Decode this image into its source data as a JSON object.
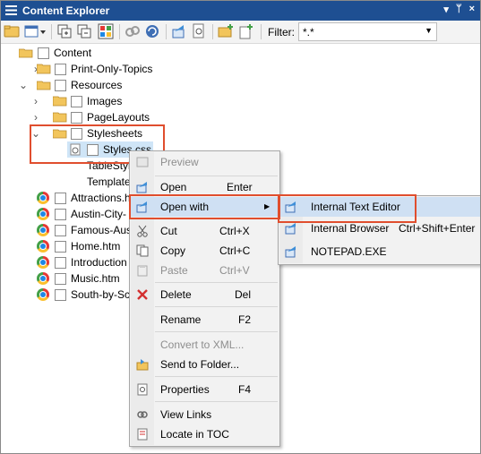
{
  "window": {
    "title": "Content Explorer",
    "pin_glyph": "▾",
    "close_glyph": "×",
    "pin2_glyph": "ᛘ"
  },
  "toolbar": {
    "filter_label": "Filter:",
    "filter_value": "*.*"
  },
  "tree": {
    "root": "Content",
    "items": [
      {
        "label": "Print-Only-Topics"
      },
      {
        "label": "Resources"
      },
      {
        "label": "Images"
      },
      {
        "label": "PageLayouts"
      },
      {
        "label": "Stylesheets"
      },
      {
        "label": "Styles.css"
      },
      {
        "label": "TableStyl"
      },
      {
        "label": "Template"
      },
      {
        "label": "Attractions.h"
      },
      {
        "label": "Austin-City-"
      },
      {
        "label": "Famous-Aus"
      },
      {
        "label": "Home.htm"
      },
      {
        "label": "Introduction"
      },
      {
        "label": "Music.htm"
      },
      {
        "label": "South-by-Sc"
      }
    ]
  },
  "context_menu": {
    "items": [
      {
        "label": "Preview",
        "shortcut": "",
        "disabled": true
      },
      {
        "label": "Open",
        "shortcut": "Enter"
      },
      {
        "label": "Open with",
        "shortcut": "",
        "submenu_arrow": "▶"
      },
      {
        "label": "Cut",
        "shortcut": "Ctrl+X"
      },
      {
        "label": "Copy",
        "shortcut": "Ctrl+C"
      },
      {
        "label": "Paste",
        "shortcut": "Ctrl+V",
        "disabled": true
      },
      {
        "label": "Delete",
        "shortcut": "Del"
      },
      {
        "label": "Rename",
        "shortcut": "F2"
      },
      {
        "label": "Convert to XML...",
        "shortcut": "",
        "disabled": true
      },
      {
        "label": "Send to Folder...",
        "shortcut": ""
      },
      {
        "label": "Properties",
        "shortcut": "F4"
      },
      {
        "label": "View Links",
        "shortcut": ""
      },
      {
        "label": "Locate in TOC",
        "shortcut": ""
      }
    ]
  },
  "submenu": {
    "items": [
      {
        "label": "Internal Text Editor",
        "shortcut": ""
      },
      {
        "label": "Internal Browser",
        "shortcut": "Ctrl+Shift+Enter"
      },
      {
        "label": "NOTEPAD.EXE",
        "shortcut": ""
      }
    ]
  },
  "colors": {
    "titlebar": "#1e4f92",
    "highlight": "#cfe0f3",
    "annotation_red": "#e04e2e",
    "folder": "#f2c55c"
  }
}
